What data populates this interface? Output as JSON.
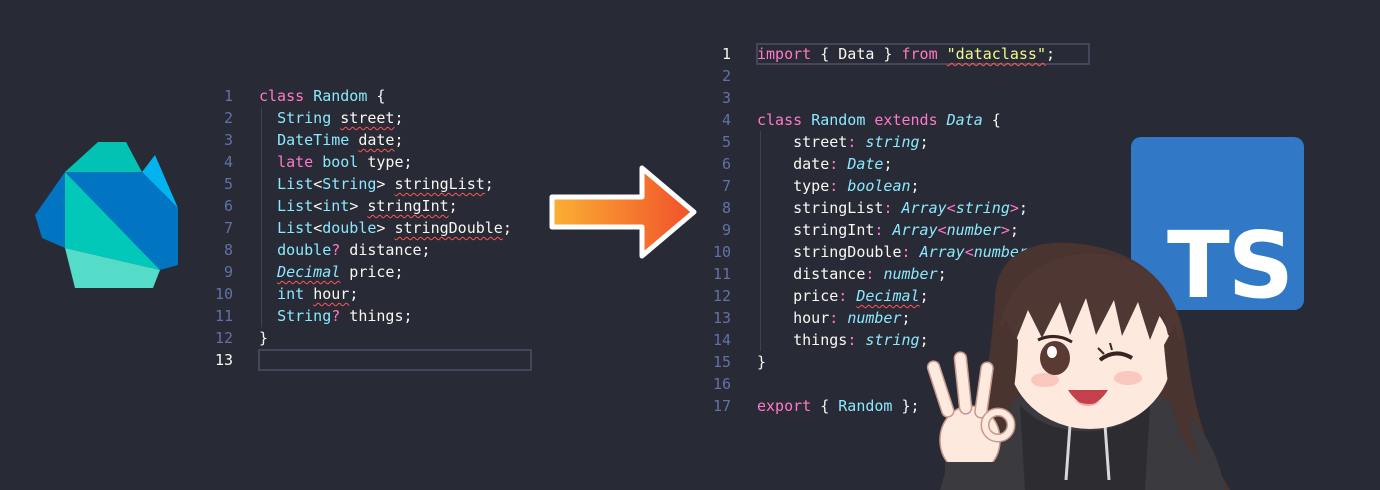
{
  "colors": {
    "background": "#282a36",
    "keyword": "#ff79c6",
    "type": "#8be9fd",
    "string": "#f1fa8c",
    "text": "#f8f8f2",
    "line_number": "#6272a4",
    "error_squiggle": "#ff5555",
    "arrow_start": "#fbb034",
    "arrow_end": "#f0502a",
    "ts_blue": "#3178c6"
  },
  "icons": {
    "dart_logo": "dart-logo-icon",
    "arrow": "right-arrow-icon",
    "typescript_logo": "typescript-logo-icon",
    "character": "anime-girl-ok-gesture-illustration"
  },
  "ts_logo_text": "TS",
  "dart_panel": {
    "language": "Dart",
    "active_line": 13,
    "lines": [
      {
        "n": "1",
        "tokens": [
          {
            "t": "class",
            "c": "kw"
          },
          {
            "t": " ",
            "c": "p"
          },
          {
            "t": "Random",
            "c": "cls"
          },
          {
            "t": " {",
            "c": "p"
          }
        ]
      },
      {
        "n": "2",
        "tokens": [
          {
            "t": "  ",
            "c": "p"
          },
          {
            "t": "String",
            "c": "ty"
          },
          {
            "t": " ",
            "c": "p"
          },
          {
            "t": "street",
            "c": "p",
            "sq": true
          },
          {
            "t": ";",
            "c": "p"
          }
        ]
      },
      {
        "n": "3",
        "tokens": [
          {
            "t": "  ",
            "c": "p"
          },
          {
            "t": "DateTime",
            "c": "ty"
          },
          {
            "t": " ",
            "c": "p"
          },
          {
            "t": "date",
            "c": "p",
            "sq": true
          },
          {
            "t": ";",
            "c": "p"
          }
        ]
      },
      {
        "n": "4",
        "tokens": [
          {
            "t": "  ",
            "c": "p"
          },
          {
            "t": "late",
            "c": "kw"
          },
          {
            "t": " ",
            "c": "p"
          },
          {
            "t": "bool",
            "c": "ty"
          },
          {
            "t": " type;",
            "c": "p"
          }
        ]
      },
      {
        "n": "5",
        "tokens": [
          {
            "t": "  ",
            "c": "p"
          },
          {
            "t": "List",
            "c": "ty"
          },
          {
            "t": "<",
            "c": "p"
          },
          {
            "t": "String",
            "c": "ty"
          },
          {
            "t": "> ",
            "c": "p"
          },
          {
            "t": "stringList",
            "c": "p",
            "sq": true
          },
          {
            "t": ";",
            "c": "p"
          }
        ]
      },
      {
        "n": "6",
        "tokens": [
          {
            "t": "  ",
            "c": "p"
          },
          {
            "t": "List",
            "c": "ty"
          },
          {
            "t": "<",
            "c": "p"
          },
          {
            "t": "int",
            "c": "ty"
          },
          {
            "t": "> ",
            "c": "p"
          },
          {
            "t": "stringInt",
            "c": "p",
            "sq": true
          },
          {
            "t": ";",
            "c": "p"
          }
        ]
      },
      {
        "n": "7",
        "tokens": [
          {
            "t": "  ",
            "c": "p"
          },
          {
            "t": "List",
            "c": "ty"
          },
          {
            "t": "<",
            "c": "p"
          },
          {
            "t": "double",
            "c": "ty"
          },
          {
            "t": "> ",
            "c": "p"
          },
          {
            "t": "stringDouble",
            "c": "p",
            "sq": true
          },
          {
            "t": ";",
            "c": "p"
          }
        ]
      },
      {
        "n": "8",
        "tokens": [
          {
            "t": "  ",
            "c": "p"
          },
          {
            "t": "double",
            "c": "ty"
          },
          {
            "t": "?",
            "c": "op"
          },
          {
            "t": " distance;",
            "c": "p"
          }
        ]
      },
      {
        "n": "9",
        "tokens": [
          {
            "t": "  ",
            "c": "p"
          },
          {
            "t": "Decimal",
            "c": "tyi",
            "sq": true
          },
          {
            "t": " price;",
            "c": "p"
          }
        ]
      },
      {
        "n": "10",
        "tokens": [
          {
            "t": "  ",
            "c": "p"
          },
          {
            "t": "int",
            "c": "ty"
          },
          {
            "t": " ",
            "c": "p"
          },
          {
            "t": "hour",
            "c": "p",
            "sq": true
          },
          {
            "t": ";",
            "c": "p"
          }
        ]
      },
      {
        "n": "11",
        "tokens": [
          {
            "t": "  ",
            "c": "p"
          },
          {
            "t": "String",
            "c": "ty"
          },
          {
            "t": "?",
            "c": "op"
          },
          {
            "t": " things;",
            "c": "p"
          }
        ]
      },
      {
        "n": "12",
        "tokens": [
          {
            "t": "}",
            "c": "p"
          }
        ]
      },
      {
        "n": "13",
        "tokens": []
      }
    ]
  },
  "ts_panel": {
    "language": "TypeScript",
    "active_line": 1,
    "lines": [
      {
        "n": "1",
        "tokens": [
          {
            "t": "import",
            "c": "kw"
          },
          {
            "t": " { Data } ",
            "c": "p"
          },
          {
            "t": "from",
            "c": "kw"
          },
          {
            "t": " ",
            "c": "p"
          },
          {
            "t": "\"dataclass\"",
            "c": "str",
            "sq": true
          },
          {
            "t": ";",
            "c": "p"
          }
        ]
      },
      {
        "n": "2",
        "tokens": []
      },
      {
        "n": "3",
        "tokens": []
      },
      {
        "n": "4",
        "tokens": [
          {
            "t": "class",
            "c": "kw"
          },
          {
            "t": " ",
            "c": "p"
          },
          {
            "t": "Random",
            "c": "cls"
          },
          {
            "t": " ",
            "c": "p"
          },
          {
            "t": "extends",
            "c": "kw"
          },
          {
            "t": " ",
            "c": "p"
          },
          {
            "t": "Data",
            "c": "tyi"
          },
          {
            "t": " {",
            "c": "p"
          }
        ]
      },
      {
        "n": "5",
        "tokens": [
          {
            "t": "    street",
            "c": "p"
          },
          {
            "t": ":",
            "c": "op"
          },
          {
            "t": " ",
            "c": "p"
          },
          {
            "t": "string",
            "c": "tyi"
          },
          {
            "t": ";",
            "c": "p"
          }
        ]
      },
      {
        "n": "6",
        "tokens": [
          {
            "t": "    date",
            "c": "p"
          },
          {
            "t": ":",
            "c": "op"
          },
          {
            "t": " ",
            "c": "p"
          },
          {
            "t": "Date",
            "c": "tyi"
          },
          {
            "t": ";",
            "c": "p"
          }
        ]
      },
      {
        "n": "7",
        "tokens": [
          {
            "t": "    type",
            "c": "p"
          },
          {
            "t": ":",
            "c": "op"
          },
          {
            "t": " ",
            "c": "p"
          },
          {
            "t": "boolean",
            "c": "tyi"
          },
          {
            "t": ";",
            "c": "p"
          }
        ]
      },
      {
        "n": "8",
        "tokens": [
          {
            "t": "    stringList",
            "c": "p"
          },
          {
            "t": ":",
            "c": "op"
          },
          {
            "t": " ",
            "c": "p"
          },
          {
            "t": "Array",
            "c": "tyi"
          },
          {
            "t": "<",
            "c": "op"
          },
          {
            "t": "string",
            "c": "tyi"
          },
          {
            "t": ">",
            "c": "op"
          },
          {
            "t": ";",
            "c": "p"
          }
        ]
      },
      {
        "n": "9",
        "tokens": [
          {
            "t": "    stringInt",
            "c": "p"
          },
          {
            "t": ":",
            "c": "op"
          },
          {
            "t": " ",
            "c": "p"
          },
          {
            "t": "Array",
            "c": "tyi"
          },
          {
            "t": "<",
            "c": "op"
          },
          {
            "t": "number",
            "c": "tyi"
          },
          {
            "t": ">",
            "c": "op"
          },
          {
            "t": ";",
            "c": "p"
          }
        ]
      },
      {
        "n": "10",
        "tokens": [
          {
            "t": "    stringDouble",
            "c": "p"
          },
          {
            "t": ":",
            "c": "op"
          },
          {
            "t": " ",
            "c": "p"
          },
          {
            "t": "Array",
            "c": "tyi"
          },
          {
            "t": "<",
            "c": "op"
          },
          {
            "t": "number",
            "c": "tyi"
          },
          {
            "t": ">",
            "c": "op"
          },
          {
            "t": ";",
            "c": "p"
          }
        ]
      },
      {
        "n": "11",
        "tokens": [
          {
            "t": "    distance",
            "c": "p"
          },
          {
            "t": ":",
            "c": "op"
          },
          {
            "t": " ",
            "c": "p"
          },
          {
            "t": "number",
            "c": "tyi"
          },
          {
            "t": ";",
            "c": "p"
          }
        ]
      },
      {
        "n": "12",
        "tokens": [
          {
            "t": "    price",
            "c": "p"
          },
          {
            "t": ":",
            "c": "op"
          },
          {
            "t": " ",
            "c": "p"
          },
          {
            "t": "Decimal",
            "c": "tyi",
            "sq": true
          },
          {
            "t": ";",
            "c": "p"
          }
        ]
      },
      {
        "n": "13",
        "tokens": [
          {
            "t": "    hour",
            "c": "p"
          },
          {
            "t": ":",
            "c": "op"
          },
          {
            "t": " ",
            "c": "p"
          },
          {
            "t": "number",
            "c": "tyi"
          },
          {
            "t": ";",
            "c": "p"
          }
        ]
      },
      {
        "n": "14",
        "tokens": [
          {
            "t": "    things",
            "c": "p"
          },
          {
            "t": ":",
            "c": "op"
          },
          {
            "t": " ",
            "c": "p"
          },
          {
            "t": "string",
            "c": "tyi"
          },
          {
            "t": ";",
            "c": "p"
          }
        ]
      },
      {
        "n": "15",
        "tokens": [
          {
            "t": "}",
            "c": "p"
          }
        ]
      },
      {
        "n": "16",
        "tokens": []
      },
      {
        "n": "17",
        "tokens": [
          {
            "t": "export",
            "c": "kw"
          },
          {
            "t": " { ",
            "c": "p"
          },
          {
            "t": "Random",
            "c": "cls"
          },
          {
            "t": " };",
            "c": "p"
          }
        ]
      }
    ]
  }
}
